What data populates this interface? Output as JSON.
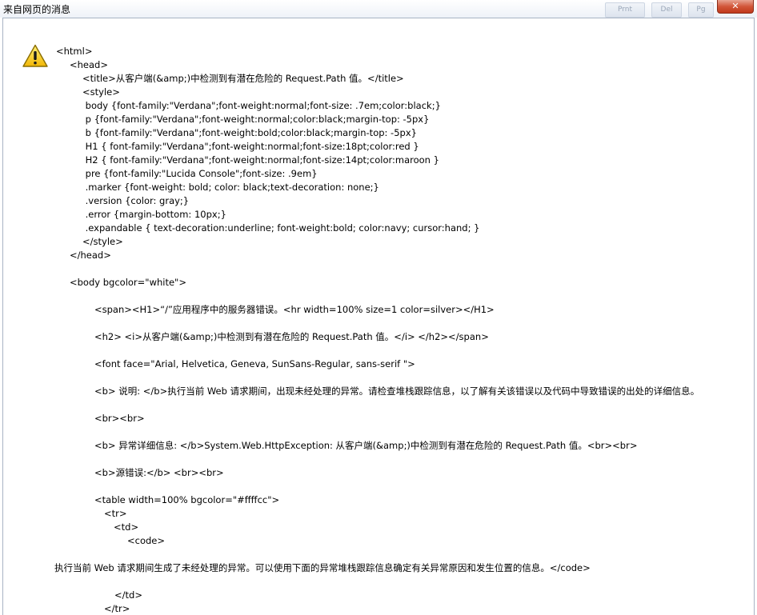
{
  "window": {
    "title": "来自网页的消息",
    "close_glyph": "✕",
    "icon": "warning-icon",
    "background_buttons": [
      "Prnt",
      "Del",
      "Pg"
    ]
  },
  "message_lines": [
    "<html>",
    "<head>",
    "<title>从客户端(&amp;)中检测到有潜在危险的 Request.Path 值。</title>",
    "<style>",
    " body {font-family:\"Verdana\";font-weight:normal;font-size: .7em;color:black;}",
    " p {font-family:\"Verdana\";font-weight:normal;color:black;margin-top: -5px}",
    " b {font-family:\"Verdana\";font-weight:bold;color:black;margin-top: -5px}",
    " H1 { font-family:\"Verdana\";font-weight:normal;font-size:18pt;color:red }",
    " H2 { font-family:\"Verdana\";font-weight:normal;font-size:14pt;color:maroon }",
    " pre {font-family:\"Lucida Console\";font-size: .9em}",
    " .marker {font-weight: bold; color: black;text-decoration: none;}",
    " .version {color: gray;}",
    " .error {margin-bottom: 10px;}",
    " .expandable { text-decoration:underline; font-weight:bold; color:navy; cursor:hand; }",
    "</style>",
    "</head>",
    "<body bgcolor=\"white\">",
    "<span><H1>“/”应用程序中的服务器错误。<hr width=100% size=1 color=silver></H1>",
    "<h2> <i>从客户端(&amp;)中检测到有潜在危险的 Request.Path 值。</i> </h2></span>",
    "<font face=\"Arial, Helvetica, Geneva, SunSans-Regular, sans-serif \">",
    "<b> 说明: </b>执行当前 Web 请求期间，出现未经处理的异常。请检查堆栈跟踪信息，以了解有关该错误以及代码中导致错误的出处的详细信息。",
    "<br><br>",
    "<b> 异常详细信息: </b>System.Web.HttpException: 从客户端(&amp;)中检测到有潜在危险的 Request.Path 值。<br><br>",
    "<b>源错误:</b> <br><br>",
    "<table width=100% bgcolor=\"#ffffcc\">",
    "<tr>",
    "<td>",
    "<code>",
    "执行当前 Web 请求期间生成了未经处理的异常。可以使用下面的异常堆栈跟踪信息确定有关异常原因和发生位置的信息。</code>",
    "</td>",
    "</tr>"
  ]
}
